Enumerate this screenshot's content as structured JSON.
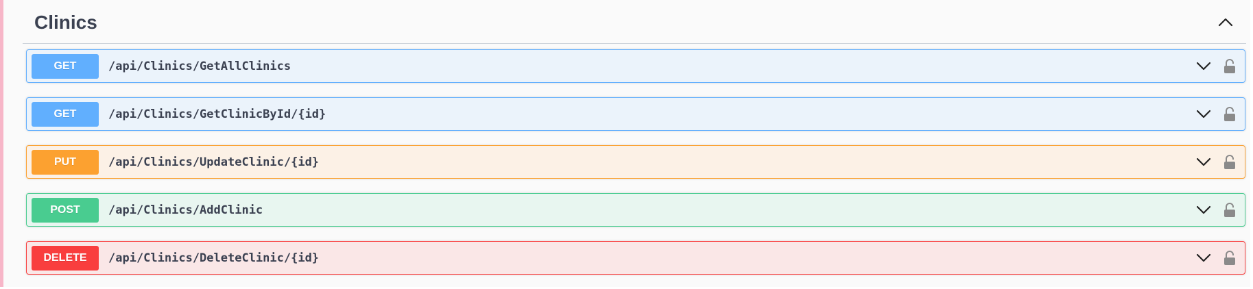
{
  "section": {
    "title": "Clinics",
    "collapse_icon": "chevron-up-icon"
  },
  "operations": [
    {
      "method": "GET",
      "path": "/api/Clinics/GetAllClinics",
      "color": "#61affe"
    },
    {
      "method": "GET",
      "path": "/api/Clinics/GetClinicById/{id}",
      "color": "#61affe"
    },
    {
      "method": "PUT",
      "path": "/api/Clinics/UpdateClinic/{id}",
      "color": "#fca130"
    },
    {
      "method": "POST",
      "path": "/api/Clinics/AddClinic",
      "color": "#49cc90"
    },
    {
      "method": "DELETE",
      "path": "/api/Clinics/DeleteClinic/{id}",
      "color": "#f93e3e"
    }
  ],
  "icons": {
    "expand": "chevron-down-icon",
    "auth": "unlocked-icon"
  }
}
